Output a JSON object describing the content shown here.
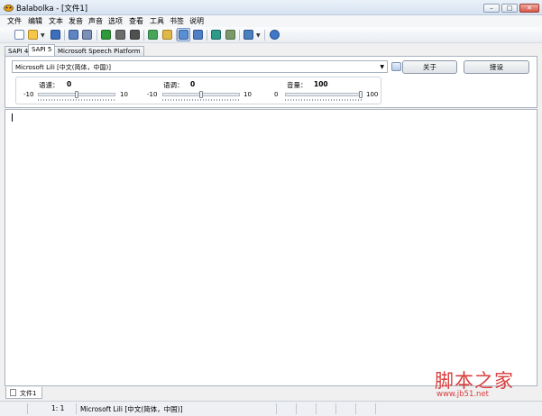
{
  "window": {
    "title": "Balabolka - [文件1]"
  },
  "menu": [
    "文件",
    "编辑",
    "文本",
    "发音",
    "声音",
    "选项",
    "查看",
    "工具",
    "书签",
    "说明"
  ],
  "toolbar_icons": [
    "new-file-icon",
    "open-folder-icon",
    "dropdown-arrow-icon",
    "save-icon",
    "print-icon",
    "print-preview-icon",
    "cut-icon",
    "play-icon",
    "pause-icon",
    "stop-icon",
    "bookmark-icon",
    "bookmark-next-icon",
    "view-mode-icon",
    "clipboard-icon",
    "refresh-icon",
    "export-icon",
    "speak-icon",
    "dropdown-arrow-icon",
    "help-icon"
  ],
  "engine_tabs": [
    "SAPI 4",
    "SAPI 5",
    "Microsoft Speech Platform"
  ],
  "active_engine_tab": "SAPI 5",
  "voice": {
    "selected": "Microsoft Lili [中文(简体，中国)]"
  },
  "buttons": {
    "about": "关于",
    "settings": "接设"
  },
  "params": {
    "rate": {
      "label": "语速：",
      "value": "0",
      "min": "-10",
      "max": "10",
      "level": 0.5
    },
    "pitch": {
      "label": "语调：",
      "value": "0",
      "min": "-10",
      "max": "10",
      "level": 0.5
    },
    "volume": {
      "label": "音量：",
      "value": "100",
      "min": "0",
      "max": "100",
      "level": 1.0
    }
  },
  "document_tab": {
    "label": "文件1"
  },
  "status": {
    "position": "1:     1",
    "voice": "Microsoft Lili [中文(简体，中国)]"
  },
  "watermark": {
    "text": "脚本之家",
    "url": "www.jb51.net"
  }
}
